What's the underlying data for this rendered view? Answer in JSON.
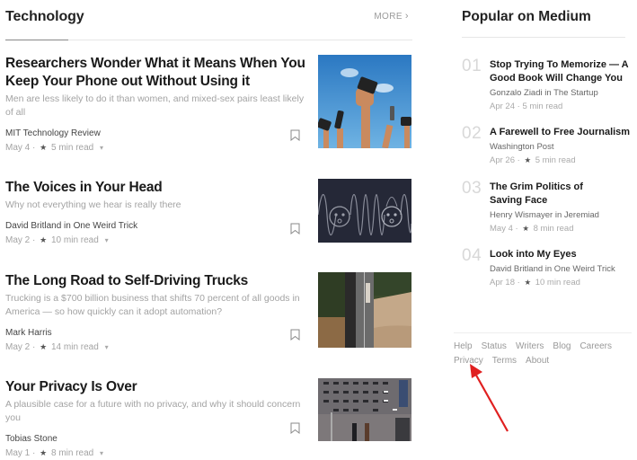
{
  "section": {
    "title": "Technology",
    "more_label": "MORE",
    "more_icon": "chevron-right-icon"
  },
  "articles": [
    {
      "title": "Researchers Wonder What it Means When You Keep Your Phone out Without Using it",
      "subtitle": "Men are less likely to do it than women, and mixed-sex pairs least likely of all",
      "author": "MIT Technology Review",
      "date": "May 4",
      "read_time": "5 min read",
      "starred": true,
      "image": "hands-raising-phones-against-blue-sky"
    },
    {
      "title": "The Voices in Your Head",
      "subtitle": "Why not everything we hear is really there",
      "author": "David Britland in One Weird Trick",
      "date": "May 2",
      "read_time": "10 min read",
      "starred": true,
      "image": "sound-wave-between-two-faces-dark"
    },
    {
      "title": "The Long Road to Self-Driving Trucks",
      "subtitle": "Trucking is a $700 billion business that shifts 70 percent of all goods in America — so how quickly can it adopt automation?",
      "author": "Mark Harris",
      "date": "May 2",
      "read_time": "14 min read",
      "starred": true,
      "image": "aerial-highway-with-truck"
    },
    {
      "title": "Your Privacy Is Over",
      "subtitle": "A plausible case for a future with no privacy, and why it should concern you",
      "author": "Tobias Stone",
      "date": "May 1",
      "read_time": "8 min read",
      "starred": true,
      "image": "wall-of-surveillance-cameras"
    }
  ],
  "popular": {
    "title": "Popular on Medium",
    "items": [
      {
        "rank": "01",
        "title": "Stop Trying To Memorize — A Good Book Will Change You",
        "author": "Gonzalo Ziadi in The Startup",
        "date": "Apr 24",
        "read_time": "5 min read",
        "starred": false
      },
      {
        "rank": "02",
        "title": "A Farewell to Free Journalism",
        "author": "Washington Post",
        "date": "Apr 26",
        "read_time": "5 min read",
        "starred": true
      },
      {
        "rank": "03",
        "title": "The Grim Politics of Saving Face",
        "author": "Henry Wismayer in Jeremiad",
        "date": "May 4",
        "read_time": "8 min read",
        "starred": true
      },
      {
        "rank": "04",
        "title": "Look into My Eyes",
        "author": "David Britland in One Weird Trick",
        "date": "Apr 18",
        "read_time": "10 min read",
        "starred": true
      }
    ]
  },
  "footer": {
    "links": [
      "Help",
      "Status",
      "Writers",
      "Blog",
      "Careers",
      "Privacy",
      "Terms",
      "About"
    ]
  },
  "annotation": {
    "arrow_color": "#e02020",
    "points_to": "Privacy"
  },
  "symbols": {
    "dot": "·",
    "star": "★",
    "caret": "⌄"
  }
}
